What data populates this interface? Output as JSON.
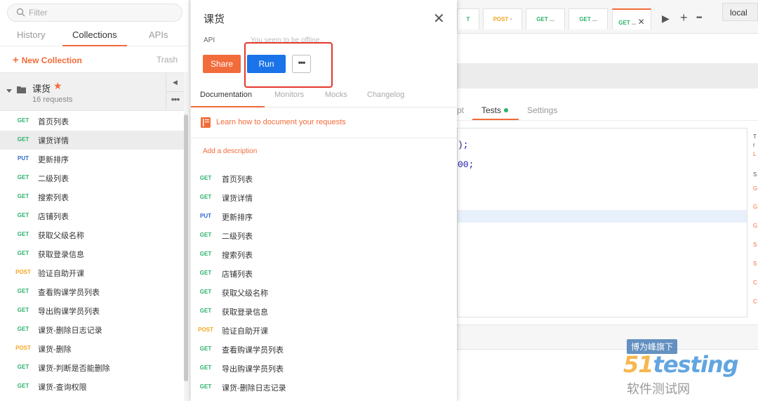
{
  "search": {
    "placeholder": "Filter"
  },
  "sidebar_tabs": [
    "History",
    "Collections",
    "APIs"
  ],
  "new_collection_label": "New Collection",
  "trash_label": "Trash",
  "collection": {
    "name": "课货",
    "count": "16 requests"
  },
  "sidebar_requests": [
    {
      "method": "GET",
      "name": "首页列表"
    },
    {
      "method": "GET",
      "name": "课货详情"
    },
    {
      "method": "PUT",
      "name": "更新排序"
    },
    {
      "method": "GET",
      "name": "二级列表"
    },
    {
      "method": "GET",
      "name": "搜索列表"
    },
    {
      "method": "GET",
      "name": "店铺列表"
    },
    {
      "method": "GET",
      "name": "获取父级名称"
    },
    {
      "method": "GET",
      "name": "获取登录信息"
    },
    {
      "method": "POST",
      "name": "验证自助开课"
    },
    {
      "method": "GET",
      "name": "查看购课学员列表"
    },
    {
      "method": "GET",
      "name": "导出购课学员列表"
    },
    {
      "method": "GET",
      "name": "课货-删除日志记录"
    },
    {
      "method": "POST",
      "name": "课货-删除"
    },
    {
      "method": "GET",
      "name": "课货-判断是否能删除"
    },
    {
      "method": "GET",
      "name": "课货-查询权限"
    }
  ],
  "panel": {
    "title": "课货",
    "api_label": "API",
    "offline_text": "You seem to be offline",
    "share_label": "Share",
    "run_label": "Run",
    "more_label": "•••",
    "tabs": [
      "Documentation",
      "Monitors",
      "Mocks",
      "Changelog"
    ],
    "learn_text": "Learn how to document your requests",
    "add_description": "Add a description",
    "requests": [
      {
        "method": "GET",
        "name": "首页列表"
      },
      {
        "method": "GET",
        "name": "课货详情"
      },
      {
        "method": "PUT",
        "name": "更新排序"
      },
      {
        "method": "GET",
        "name": "二级列表"
      },
      {
        "method": "GET",
        "name": "搜索列表"
      },
      {
        "method": "GET",
        "name": "店铺列表"
      },
      {
        "method": "GET",
        "name": "获取父级名称"
      },
      {
        "method": "GET",
        "name": "获取登录信息"
      },
      {
        "method": "POST",
        "name": "验证自助开课"
      },
      {
        "method": "GET",
        "name": "查看购课学员列表"
      },
      {
        "method": "GET",
        "name": "导出购课学员列表"
      },
      {
        "method": "GET",
        "name": "课货-删除日志记录"
      }
    ]
  },
  "request_tabs": [
    {
      "method": "GET",
      "label": "T"
    },
    {
      "method": "POST",
      "label": "POST"
    },
    {
      "method": "GET",
      "label": "GET"
    },
    {
      "method": "GET",
      "label": "GET"
    },
    {
      "method": "GET",
      "label": "GET"
    }
  ],
  "environment": "local",
  "sub_tabs": [
    "pt",
    "Tests",
    "Settings"
  ],
  "code_lines": [
    ");",
    "00;"
  ],
  "watermark": {
    "badge": "博为峰旗下",
    "logo_a": "51",
    "logo_b": "testing",
    "text": "软件测试网"
  },
  "colors": {
    "accent": "#f26b3a",
    "run_blue": "#1a73e8",
    "get": "#2cb26c",
    "put": "#2a6acf",
    "post": "#f5a623",
    "highlight_box": "#e4372c"
  }
}
